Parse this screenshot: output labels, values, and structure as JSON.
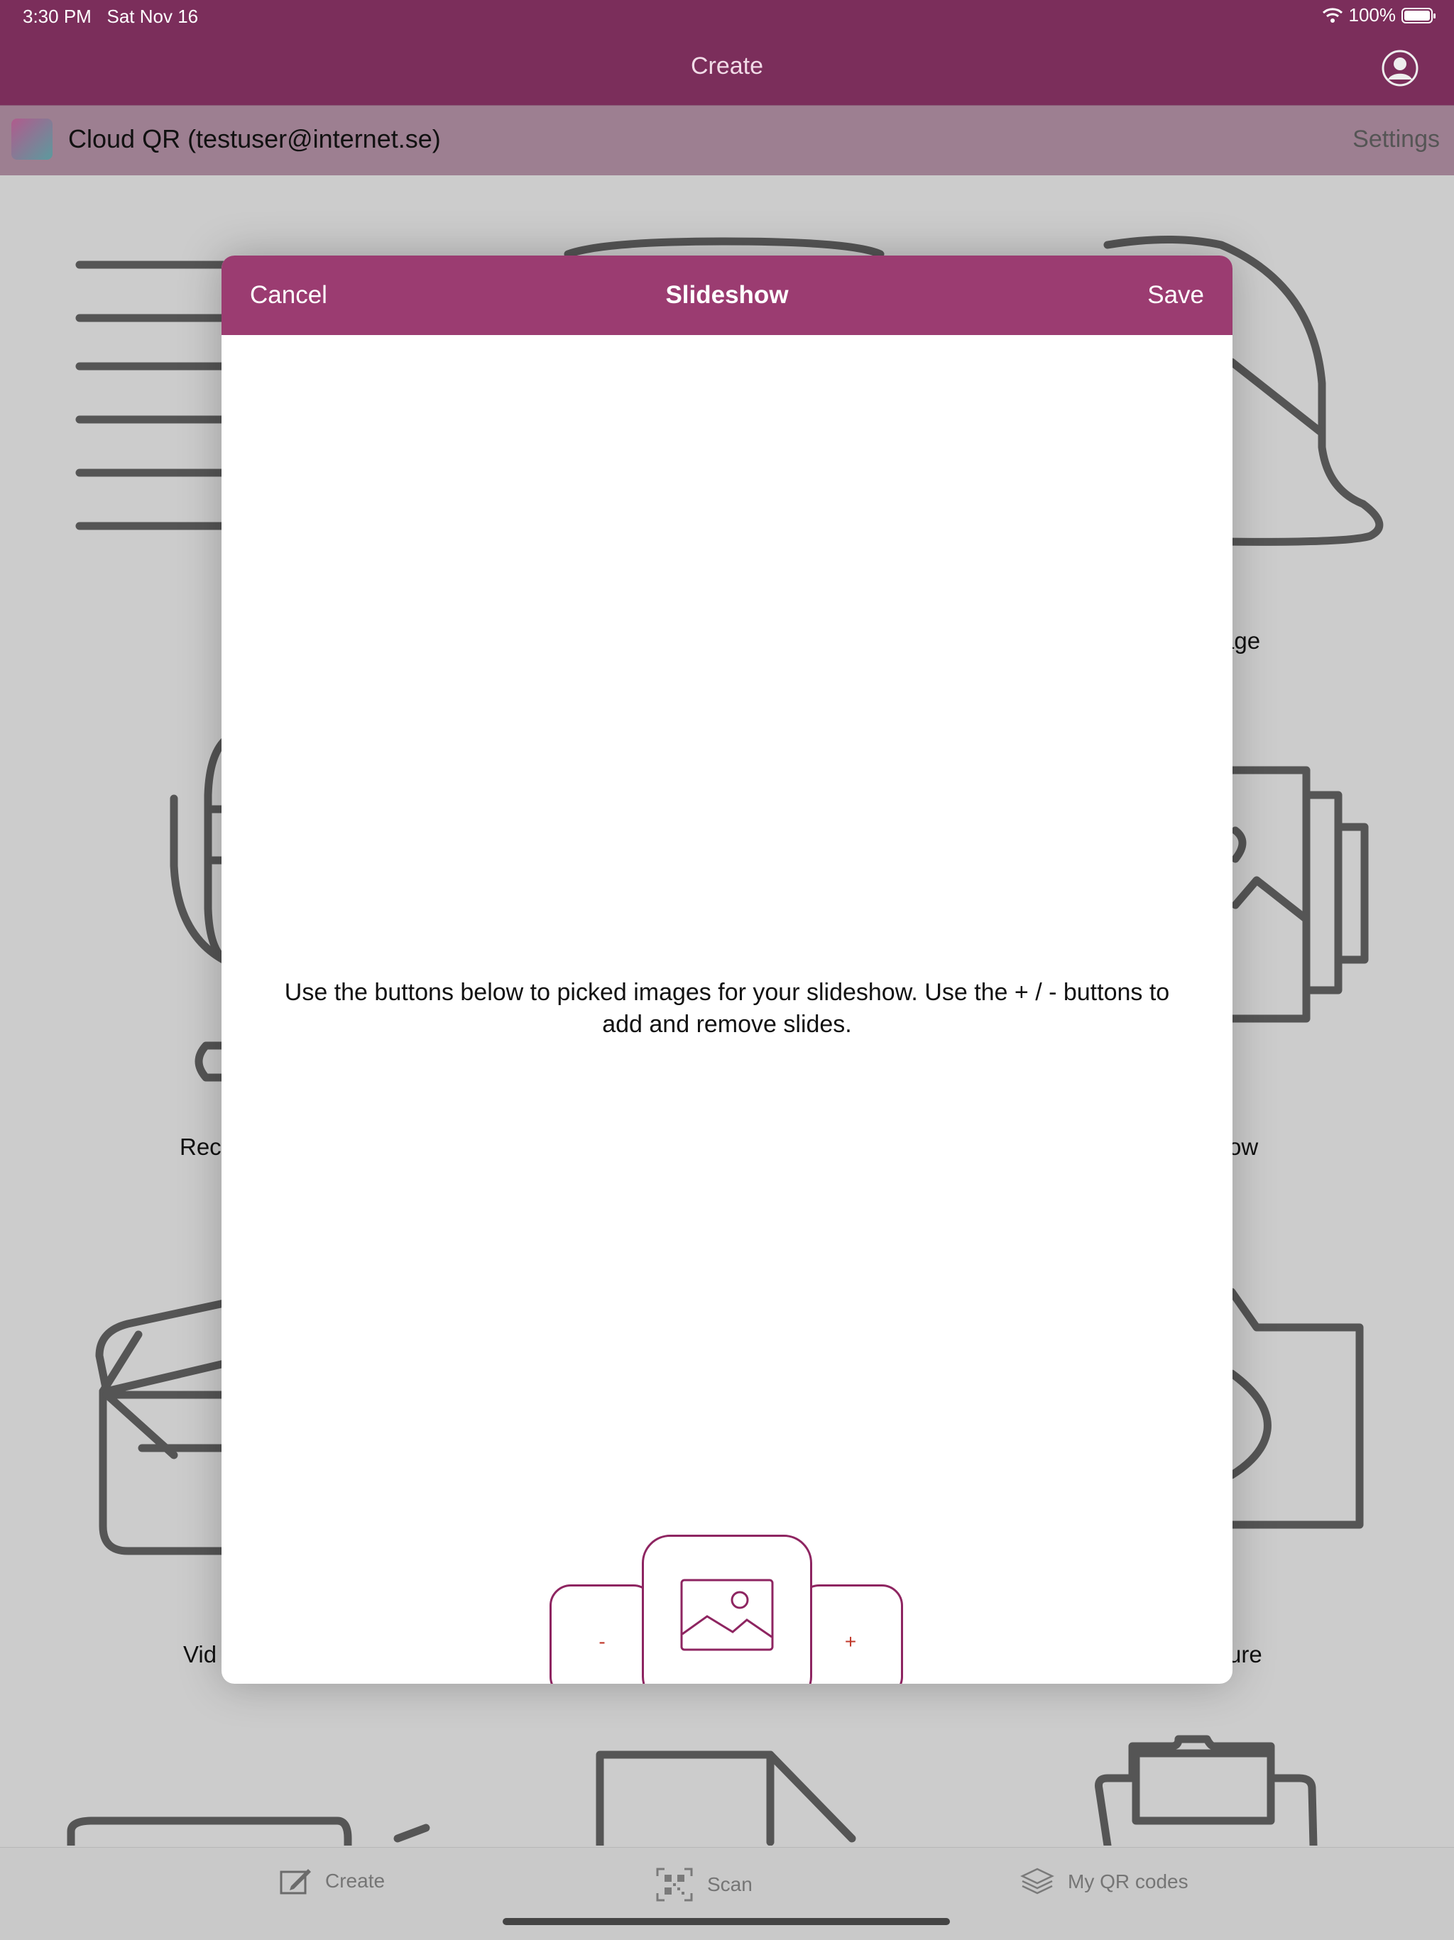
{
  "status_bar": {
    "time": "3:30 PM",
    "date": "Sat Nov 16",
    "battery": "100%"
  },
  "nav": {
    "title": "Create"
  },
  "account_bar": {
    "label": "Cloud QR (testuser@internet.se)",
    "settings": "Settings"
  },
  "background_tiles": {
    "image_fragment": "age",
    "rec_fragment": "Rec",
    "slideshow_fragment": "ow",
    "video_fragment": "Vid",
    "picture_fragment": "ure"
  },
  "modal": {
    "cancel": "Cancel",
    "title": "Slideshow",
    "save": "Save",
    "instructions": "Use the buttons below to picked images for your slideshow. Use the + / - buttons to add and remove slides.",
    "minus_label": "-",
    "plus_label": "+"
  },
  "tabbar": {
    "create": "Create",
    "scan": "Scan",
    "my_qr_codes": "My QR codes"
  },
  "colors": {
    "nav": "#7b2e5b",
    "modal_header": "#9b3c71",
    "accent": "#8e2561",
    "background": "#cccccc"
  }
}
